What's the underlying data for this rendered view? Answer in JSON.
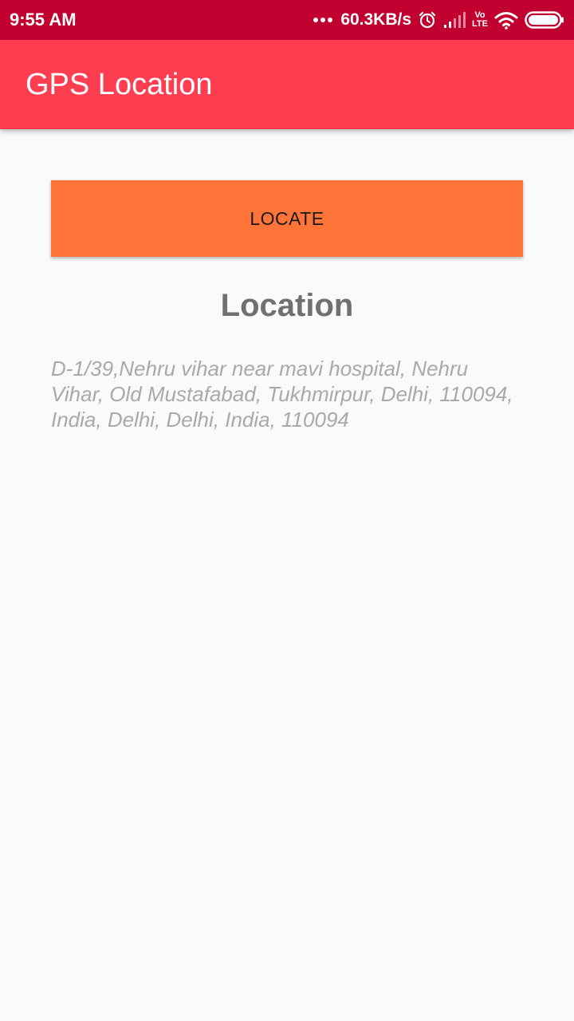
{
  "status_bar": {
    "time": "9:55 AM",
    "network_speed": "60.3KB/s",
    "volte_top": "Vo",
    "volte_bottom": "LTE",
    "color": "#c2002f",
    "icons": [
      "more-dots-icon",
      "alarm-icon",
      "signal-icon",
      "volte-icon",
      "wifi-icon",
      "battery-icon"
    ]
  },
  "app_bar": {
    "title": "GPS Location",
    "color": "#ff3d50"
  },
  "main": {
    "locate_button_label": "LOCATE",
    "locate_button_color": "#ff7539",
    "heading": "Location",
    "address": "D-1/39,Nehru vihar near mavi hospital, Nehru Vihar, Old Mustafabad, Tukhmirpur, Delhi, 110094, India, Delhi, Delhi, India, 110094"
  }
}
